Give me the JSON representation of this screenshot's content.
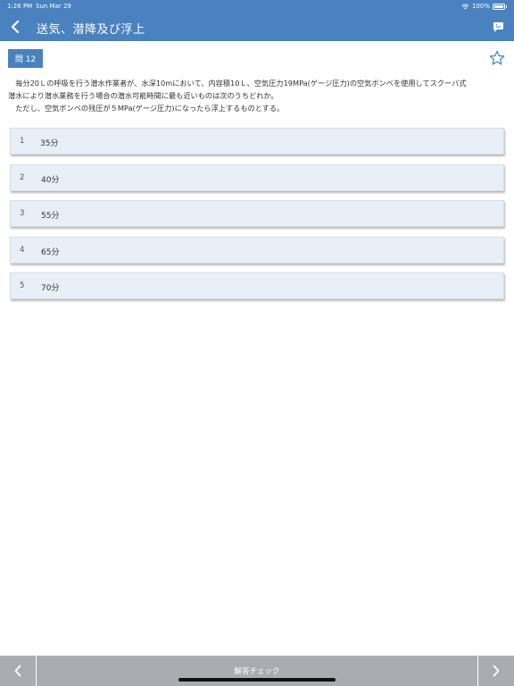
{
  "status_bar": {
    "time": "1:26 PM",
    "date": "Sun Mar 29",
    "battery": "100%"
  },
  "nav": {
    "title": "送気、潜降及び浮上"
  },
  "question": {
    "badge": "問 12",
    "lines": [
      "　毎分20Ｌの呼吸を行う潜水作業者が、水深10mにおいて、内容積10Ｌ、空気圧力19MPa(ゲージ圧力)の空気ボンベを使用してスクーバ式",
      "潜水により潜水業務を行う場合の潜水可能時間に最も近いものは次のうちどれか。",
      "　ただし、空気ボンベの残圧が５MPa(ゲージ圧力)になったら浮上するものとする。"
    ]
  },
  "options": [
    {
      "num": "1",
      "label": "35分"
    },
    {
      "num": "2",
      "label": "40分"
    },
    {
      "num": "3",
      "label": "55分"
    },
    {
      "num": "4",
      "label": "65分"
    },
    {
      "num": "5",
      "label": "70分"
    }
  ],
  "toolbar": {
    "check_label": "解答チェック"
  },
  "colors": {
    "accent": "#4a82c0",
    "option_bg": "#e9eff7",
    "toolbar_bg": "#a9acb0"
  }
}
